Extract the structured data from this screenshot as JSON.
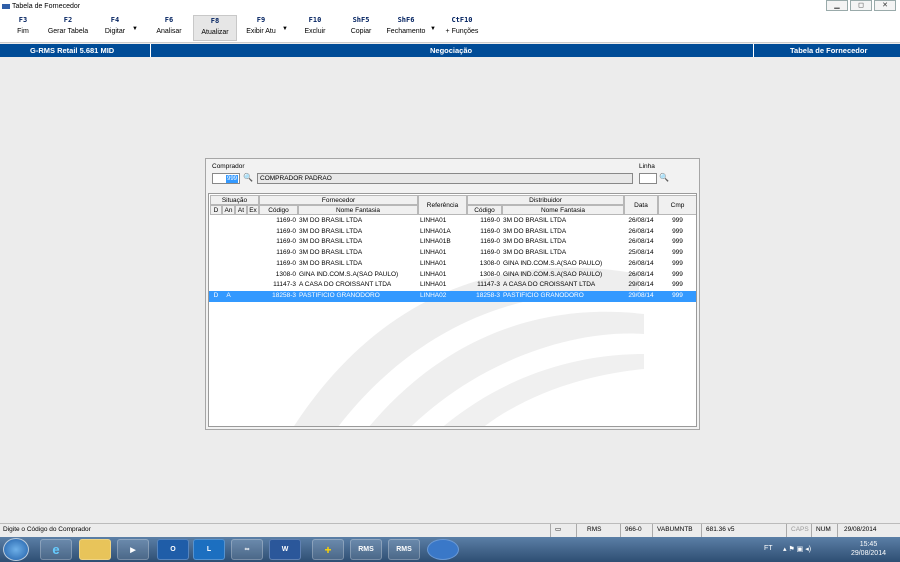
{
  "window": {
    "title": "Tabela de Fornecedor",
    "btn_min": "▁",
    "btn_max": "◻",
    "btn_close": "✕"
  },
  "fkeys": [
    {
      "key": "F3",
      "label": "Fim"
    },
    {
      "key": "F2",
      "label": "Gerar Tabela"
    },
    {
      "key": "F4",
      "label": "Digitar"
    },
    {
      "key": "F6",
      "label": "Analisar"
    },
    {
      "key": "F8",
      "label": "Atualizar"
    },
    {
      "key": "F9",
      "label": "Exibir Atu"
    },
    {
      "key": "F10",
      "label": "Excluir"
    },
    {
      "key": "ShF5",
      "label": "Copiar"
    },
    {
      "key": "ShF6",
      "label": "Fechamento"
    },
    {
      "key": "CtF10",
      "label": "+ Funções"
    }
  ],
  "bluebar": {
    "left": "G-RMS Retail 5.681 MID",
    "center": "Negociação",
    "right": "Tabela de Fornecedor"
  },
  "form": {
    "comprador_label": "Comprador",
    "comprador_code": "999",
    "comprador_name": "COMPRADOR PADRAO",
    "linha_label": "Linha",
    "linha_value": ""
  },
  "grid": {
    "headers": {
      "situacao": "Situação",
      "d": "D",
      "an": "An",
      "at": "At",
      "ex": "Ex",
      "fornecedor": "Fornecedor",
      "codigo": "Código",
      "nome_fantasia": "Nome Fantasia",
      "referencia": "Referência",
      "distribuidor": "Distribuidor",
      "dist_codigo": "Código",
      "dist_nome": "Nome Fantasia",
      "data": "Data",
      "cmp": "Cmp"
    },
    "rows": [
      {
        "d": "",
        "an": "",
        "at": "",
        "ex": "",
        "codigo": "1169-0",
        "nome": "3M DO BRASIL LTDA",
        "ref": "LINHA01",
        "dcod": "1169-0",
        "dnome": "3M DO BRASIL LTDA",
        "data": "26/08/14",
        "cmp": "999",
        "selected": false
      },
      {
        "d": "",
        "an": "",
        "at": "",
        "ex": "",
        "codigo": "1169-0",
        "nome": "3M DO BRASIL LTDA",
        "ref": "LINHA01A",
        "dcod": "1169-0",
        "dnome": "3M DO BRASIL LTDA",
        "data": "26/08/14",
        "cmp": "999",
        "selected": false
      },
      {
        "d": "",
        "an": "",
        "at": "",
        "ex": "",
        "codigo": "1169-0",
        "nome": "3M DO BRASIL LTDA",
        "ref": "LINHA01B",
        "dcod": "1169-0",
        "dnome": "3M DO BRASIL LTDA",
        "data": "26/08/14",
        "cmp": "999",
        "selected": false
      },
      {
        "d": "",
        "an": "",
        "at": "",
        "ex": "",
        "codigo": "1169-0",
        "nome": "3M DO BRASIL LTDA",
        "ref": "LINHA01",
        "dcod": "1169-0",
        "dnome": "3M DO BRASIL LTDA",
        "data": "25/08/14",
        "cmp": "999",
        "selected": false
      },
      {
        "d": "",
        "an": "",
        "at": "",
        "ex": "",
        "codigo": "1169-0",
        "nome": "3M DO BRASIL LTDA",
        "ref": "LINHA01",
        "dcod": "1308-0",
        "dnome": "GINA IND.COM.S.A(SAO PAULO)",
        "data": "26/08/14",
        "cmp": "999",
        "selected": false
      },
      {
        "d": "",
        "an": "",
        "at": "",
        "ex": "",
        "codigo": "1308-0",
        "nome": "GINA IND.COM.S.A(SAO PAULO)",
        "ref": "LINHA01",
        "dcod": "1308-0",
        "dnome": "GINA IND.COM.S.A(SAO PAULO)",
        "data": "26/08/14",
        "cmp": "999",
        "selected": false
      },
      {
        "d": "",
        "an": "",
        "at": "",
        "ex": "",
        "codigo": "11147-3",
        "nome": "A CASA DO CROISSANT LTDA",
        "ref": "LINHA01",
        "dcod": "11147-3",
        "dnome": "A CASA DO CROISSANT LTDA",
        "data": "29/08/14",
        "cmp": "999",
        "selected": false
      },
      {
        "d": "D",
        "an": "A",
        "at": "",
        "ex": "",
        "codigo": "18258-3",
        "nome": "PASTIFICIO GRANODORO",
        "ref": "LINHA02",
        "dcod": "18258-3",
        "dnome": "PASTIFICIO GRANODORO",
        "data": "29/08/14",
        "cmp": "999",
        "selected": true
      }
    ]
  },
  "status": {
    "hint": "Digite o Código do Comprador",
    "app": "RMS",
    "code": "966-0",
    "user": "VABUMNTB",
    "version": "681.36 v5",
    "caps": "CAPS",
    "num": "NUM",
    "date": "29/08/2014"
  },
  "taskbar": {
    "rms1": "RMS",
    "rms2": "RMS",
    "lang": "FT",
    "time": "15:45",
    "date": "29/08/2014"
  },
  "colors": {
    "accent": "#004c97",
    "selection": "#3399ff"
  }
}
